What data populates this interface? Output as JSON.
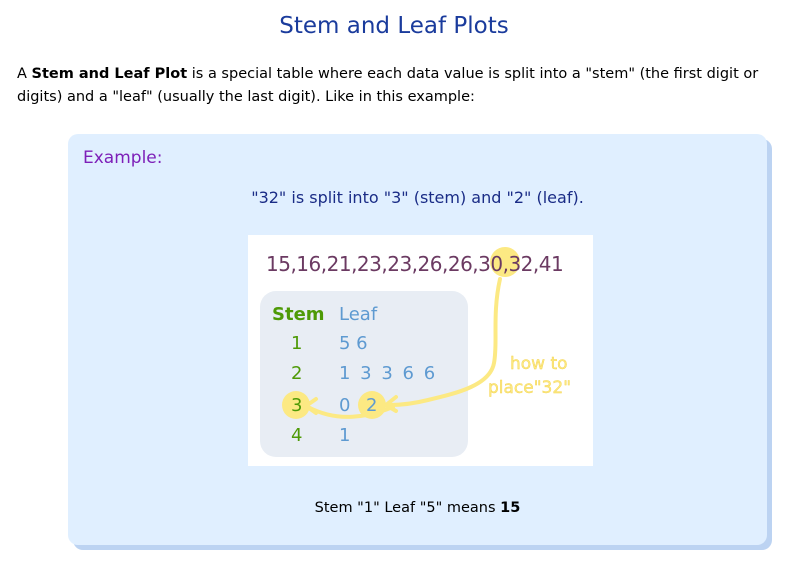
{
  "page": {
    "title": "Stem and Leaf Plots",
    "intro": {
      "prefix": "A ",
      "bold_term": "Stem and Leaf Plot",
      "suffix": " is a special table where each data value is split into a \"stem\" (the first digit or digits) and a \"leaf\" (usually the last digit). Like in this example:"
    }
  },
  "example": {
    "heading": "Example:",
    "caption": "\"32\" is split into \"3\" (stem) and \"2\" (leaf).",
    "figure": {
      "data_list_prefix": "15,16,21,23,23,26,26,30,",
      "data_highlight": "32",
      "data_list_suffix": ",41",
      "stem_header": "Stem",
      "leaf_header": "Leaf",
      "rows": [
        {
          "stem": "1",
          "leaves": "5 6"
        },
        {
          "stem": "2",
          "leaves": "1 3 3 6 6"
        },
        {
          "stem": "3",
          "leaves_before": "0",
          "leaf_highlight": "2"
        },
        {
          "stem": "4",
          "leaves": "1"
        }
      ],
      "annotation_line1": "how to",
      "annotation_line2": "place\"32\""
    },
    "note": {
      "prefix": "Stem \"1\" Leaf \"5\" means ",
      "bold_value": "15"
    }
  },
  "colors": {
    "title": "#1a3b9c",
    "heading": "#7d1fb8",
    "caption": "#1a2c86",
    "box_bg": "#e0efff",
    "data_text": "#6b3a62",
    "stem_green": "#4e9a06",
    "leaf_blue": "#5e9ad1",
    "highlight_yellow": "#fce983"
  }
}
